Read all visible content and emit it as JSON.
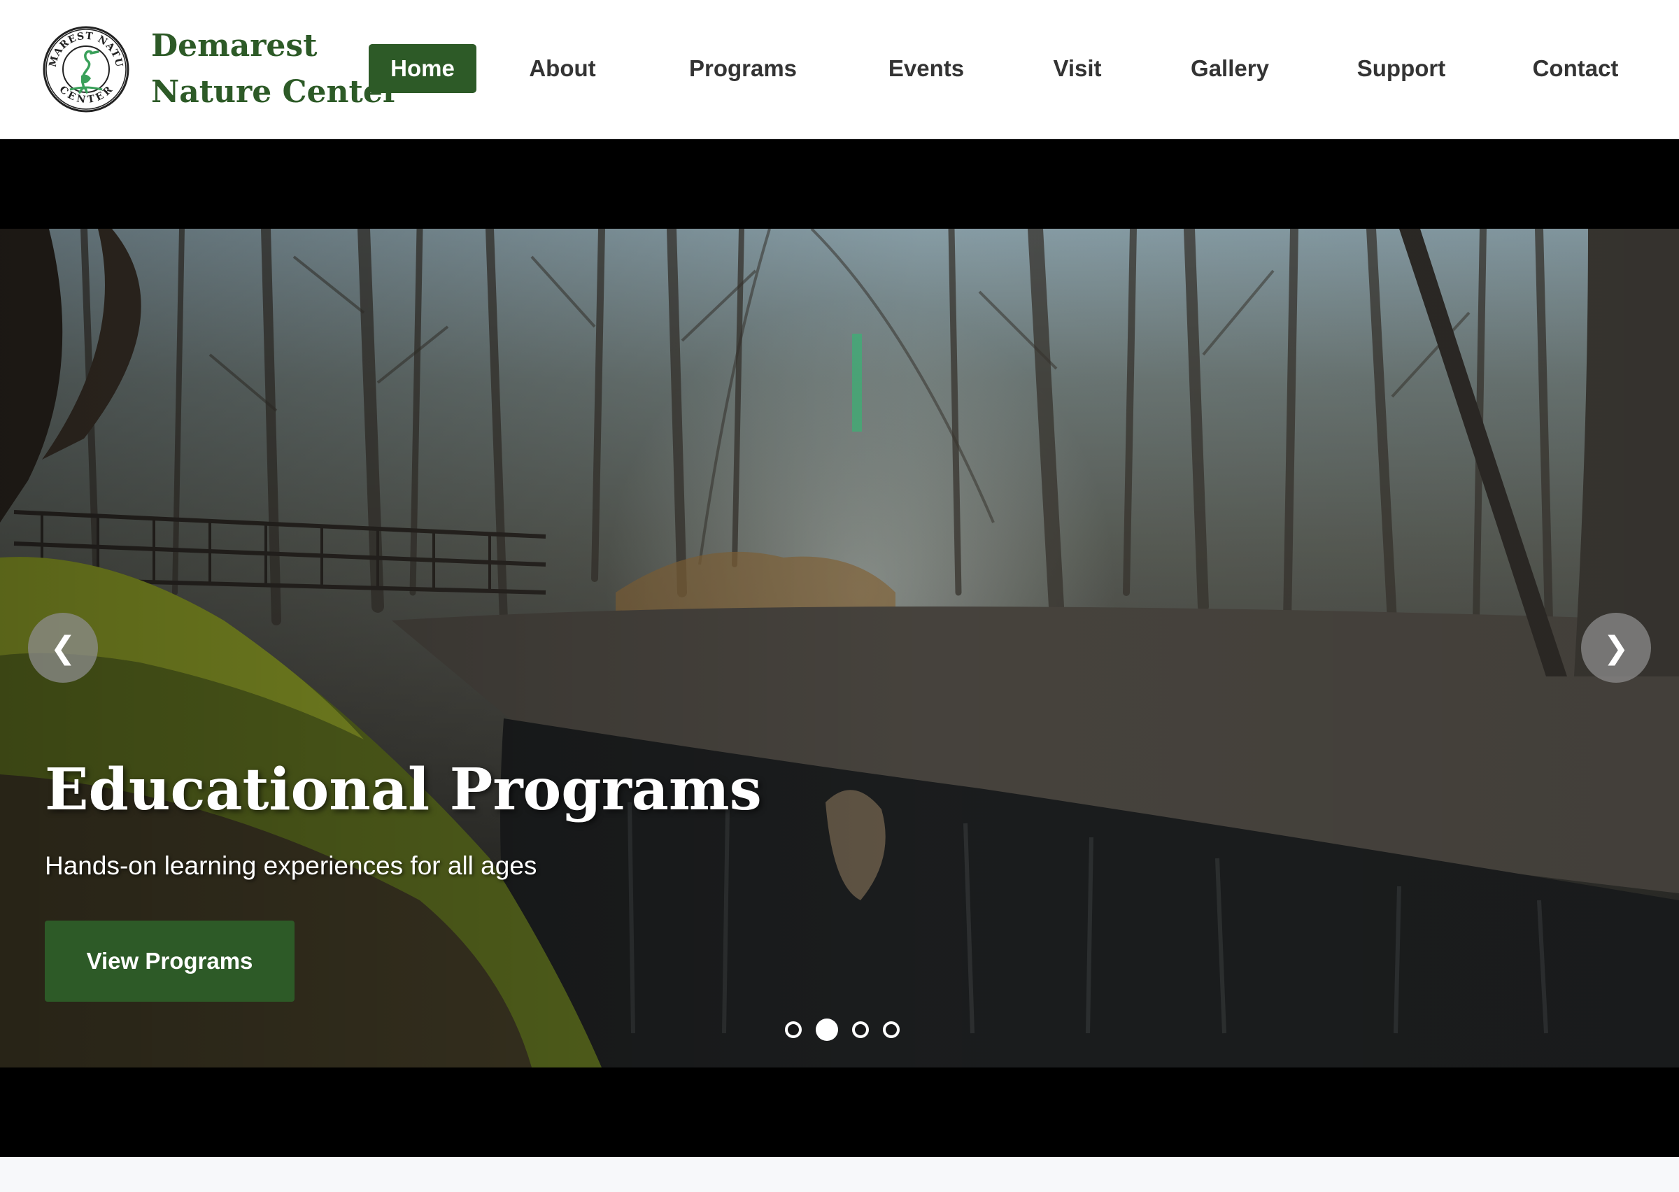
{
  "header": {
    "logo_text": "DEMAREST NATURE CENTER",
    "brand_line1": "Demarest",
    "brand_line2": "Nature Center",
    "nav": [
      {
        "label": "Home",
        "active": true
      },
      {
        "label": "About",
        "active": false
      },
      {
        "label": "Programs",
        "active": false
      },
      {
        "label": "Events",
        "active": false
      },
      {
        "label": "Visit",
        "active": false
      },
      {
        "label": "Gallery",
        "active": false
      },
      {
        "label": "Support",
        "active": false
      },
      {
        "label": "Contact",
        "active": false
      }
    ]
  },
  "hero": {
    "title": "Educational Programs",
    "subtitle": "Hands-on learning experiences for all ages",
    "cta_label": "View Programs",
    "prev_label": "❮",
    "next_label": "❯",
    "slide_count": 4,
    "active_slide": 2
  },
  "colors": {
    "brand_green": "#2d5a27",
    "nav_text": "#333333",
    "hero_bg": "#000000"
  }
}
